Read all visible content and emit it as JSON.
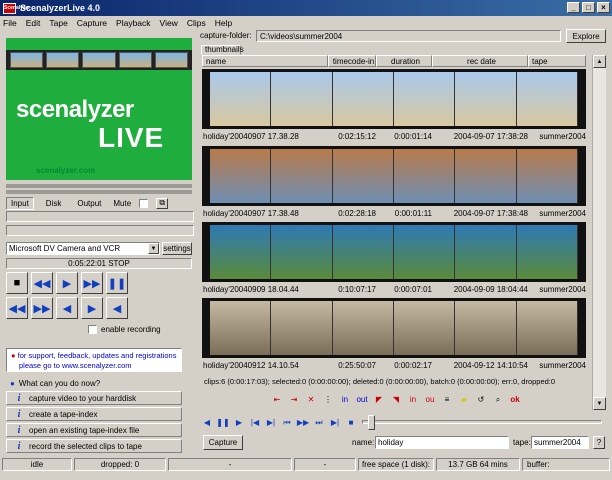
{
  "app": {
    "title": "ScenalyzerLive 4.0",
    "icon_text": "Scenalyzer"
  },
  "menu": [
    "File",
    "Edit",
    "Tape",
    "Capture",
    "Playback",
    "View",
    "Clips",
    "Help"
  ],
  "logo": {
    "scen": "scenalyzer",
    "live": "LIVE",
    "url": "scenalyzer.com"
  },
  "tabs": {
    "input": "Input",
    "disk": "Disk",
    "output": "Output",
    "mute": "Mute"
  },
  "device": {
    "value": "Microsoft DV Camera and VCR",
    "settings": "settings"
  },
  "timecode": "0:05:22:01 STOP",
  "enable_recording": "enable recording",
  "support": {
    "line1": "for support, feedback, updates and registrations",
    "line2": "please go to www.scenalyzer.com"
  },
  "what": "What can you do now?",
  "help_links": [
    "capture video to your harddisk",
    "create a tape-index",
    "open an existing tape-index file",
    "record the selected clips to tape"
  ],
  "capture_button": "Capture",
  "capture_folder": {
    "label": "capture-folder:",
    "value": "C:\\videos\\summer2004",
    "explore": "Explore"
  },
  "view_tab": "thumbnails",
  "columns": [
    "name",
    "timecode-in",
    "duration",
    "rec date",
    "tape"
  ],
  "clips": [
    {
      "name": "holiday'20040907 17.38.28",
      "tc": "0:02:15:12",
      "dur": "0:00:01:14",
      "date": "2004-09-07 17:38:28",
      "tape": "summer2004",
      "colors": [
        "#a9c8ea",
        "#d9c8a0"
      ]
    },
    {
      "name": "holiday'20040907 17.38.48",
      "tc": "0:02:28:18",
      "dur": "0:00:01:11",
      "date": "2004-09-07 17:38:48",
      "tape": "summer2004",
      "colors": [
        "#b87a4a",
        "#6e8fb5"
      ]
    },
    {
      "name": "holiday'20040909 18.04.44",
      "tc": "0:10:07:17",
      "dur": "0:00:07:01",
      "date": "2004-09-09 18:04:44",
      "tape": "summer2004",
      "colors": [
        "#2f7ab5",
        "#5a8a3a"
      ]
    },
    {
      "name": "holiday'20040912 14.10.54",
      "tc": "0:25:50:07",
      "dur": "0:00:02:17",
      "date": "2004-09-12 14:10:54",
      "tape": "summer2004",
      "colors": [
        "#c6b9a4",
        "#7a6e58"
      ]
    }
  ],
  "summary": "clips:6 (0:00:17:03); selected:0 (0:00:00:00); deleted:0 (0:00:00:00), batch:0 (0:00:00:00); err:0, dropped:0",
  "name_field": {
    "label": "name:",
    "value": "holiday"
  },
  "tape_field": {
    "label": "tape:",
    "value": "summer2004",
    "help": "?"
  },
  "status": {
    "idle": "idle",
    "dropped": "dropped: 0",
    "dash1": "-",
    "dash2": "-",
    "freespace": "free space (1 disk):",
    "size": "13.7 GB 64 mins",
    "buffer": "buffer:"
  }
}
